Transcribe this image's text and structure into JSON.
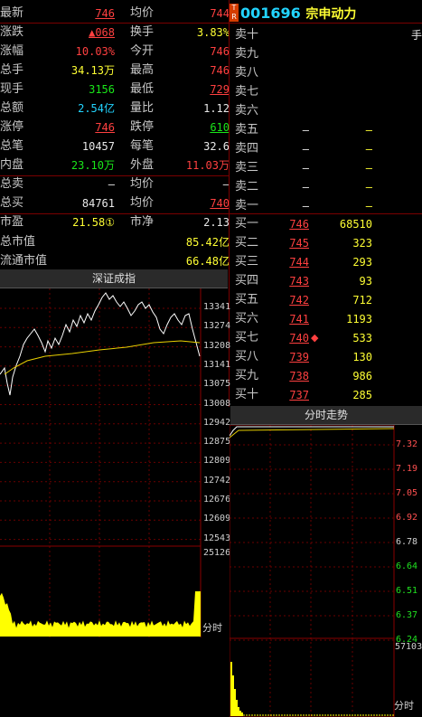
{
  "header": {
    "badge_top": "T",
    "badge_bottom": "R",
    "code": "001696",
    "name": "宗申动力",
    "right_char": "手"
  },
  "quote": {
    "rows": [
      {
        "l1": "最新",
        "v1": "746",
        "c1": "red",
        "u1": true,
        "l2": "均价",
        "v2": "744",
        "c2": "red",
        "u2": false
      },
      {
        "l1": "涨跌",
        "v1": "▲068",
        "c1": "red",
        "u1": true,
        "l2": "换手",
        "v2": "3.83%",
        "c2": "yel",
        "u2": false
      },
      {
        "l1": "涨幅",
        "v1": "10.03%",
        "c1": "red",
        "u1": false,
        "l2": "今开",
        "v2": "746",
        "c2": "red",
        "u2": false
      },
      {
        "l1": "总手",
        "v1": "34.13万",
        "c1": "yel",
        "u1": false,
        "l2": "最高",
        "v2": "746",
        "c2": "red",
        "u2": false
      },
      {
        "l1": "现手",
        "v1": "3156",
        "c1": "grn",
        "u1": false,
        "l2": "最低",
        "v2": "729",
        "c2": "red",
        "u2": true
      },
      {
        "l1": "总额",
        "v1": "2.54亿",
        "c1": "cyan",
        "u1": false,
        "l2": "量比",
        "v2": "1.12",
        "c2": "wht",
        "u2": false
      },
      {
        "l1": "涨停",
        "v1": "746",
        "c1": "red",
        "u1": true,
        "l2": "跌停",
        "v2": "610",
        "c2": "grn",
        "u2": true
      },
      {
        "l1": "总笔",
        "v1": "10457",
        "c1": "wht",
        "u1": false,
        "l2": "每笔",
        "v2": "32.6",
        "c2": "wht",
        "u2": false
      },
      {
        "l1": "内盘",
        "v1": "23.10万",
        "c1": "grn",
        "u1": false,
        "l2": "外盘",
        "v2": "11.03万",
        "c2": "red",
        "u2": false
      },
      {
        "l1": "总卖",
        "v1": "–",
        "c1": "wht",
        "u1": false,
        "l2": "均价",
        "v2": "–",
        "c2": "wht",
        "u2": false
      },
      {
        "l1": "总买",
        "v1": "84761",
        "c1": "wht",
        "u1": false,
        "l2": "均价",
        "v2": "740",
        "c2": "red",
        "u2": true
      },
      {
        "l1": "市盈",
        "v1": "21.58①",
        "c1": "yel",
        "u1": false,
        "l2": "市净",
        "v2": "2.13",
        "c2": "wht",
        "u2": false
      }
    ],
    "market_cap_label": "总市值",
    "market_cap": "85.42亿",
    "float_cap_label": "流通市值",
    "float_cap": "66.48亿"
  },
  "order_book": {
    "sells": [
      {
        "label": "卖十",
        "price": "",
        "vol": ""
      },
      {
        "label": "卖九",
        "price": "",
        "vol": ""
      },
      {
        "label": "卖八",
        "price": "",
        "vol": ""
      },
      {
        "label": "卖七",
        "price": "",
        "vol": ""
      },
      {
        "label": "卖六",
        "price": "",
        "vol": ""
      },
      {
        "label": "卖五",
        "price": "–",
        "vol": "–"
      },
      {
        "label": "卖四",
        "price": "–",
        "vol": "–"
      },
      {
        "label": "卖三",
        "price": "–",
        "vol": "–"
      },
      {
        "label": "卖二",
        "price": "–",
        "vol": "–"
      },
      {
        "label": "卖一",
        "price": "–",
        "vol": "–"
      }
    ],
    "buys": [
      {
        "label": "买一",
        "price": "746",
        "vol": "68510",
        "mark": ""
      },
      {
        "label": "买二",
        "price": "745",
        "vol": "323",
        "mark": ""
      },
      {
        "label": "买三",
        "price": "744",
        "vol": "293",
        "mark": ""
      },
      {
        "label": "买四",
        "price": "743",
        "vol": "93",
        "mark": ""
      },
      {
        "label": "买五",
        "price": "742",
        "vol": "712",
        "mark": ""
      },
      {
        "label": "买六",
        "price": "741",
        "vol": "1193",
        "mark": ""
      },
      {
        "label": "买七",
        "price": "740",
        "vol": "533",
        "mark": "◆"
      },
      {
        "label": "买八",
        "price": "739",
        "vol": "130",
        "mark": ""
      },
      {
        "label": "买九",
        "price": "738",
        "vol": "986",
        "mark": ""
      },
      {
        "label": "买十",
        "price": "737",
        "vol": "285",
        "mark": ""
      }
    ]
  },
  "index_chart": {
    "title": "深证成指",
    "y_ticks": [
      "13341",
      "13274",
      "13208",
      "13141",
      "13075",
      "13008",
      "12942",
      "12875",
      "12809",
      "12742",
      "12676",
      "12609",
      "12543"
    ],
    "vol_max": "25126",
    "x_label": "分时",
    "colors": {
      "price": "#ffffff",
      "avg": "#e8d000",
      "volume": "#ffff00"
    }
  },
  "stock_chart": {
    "title": "分时走势",
    "y_ticks": [
      "7.32",
      "7.19",
      "7.05",
      "6.92",
      "6.78",
      "6.64",
      "6.51",
      "6.37",
      "6.24"
    ],
    "vol_max": "57103",
    "x_label": "分时"
  }
}
